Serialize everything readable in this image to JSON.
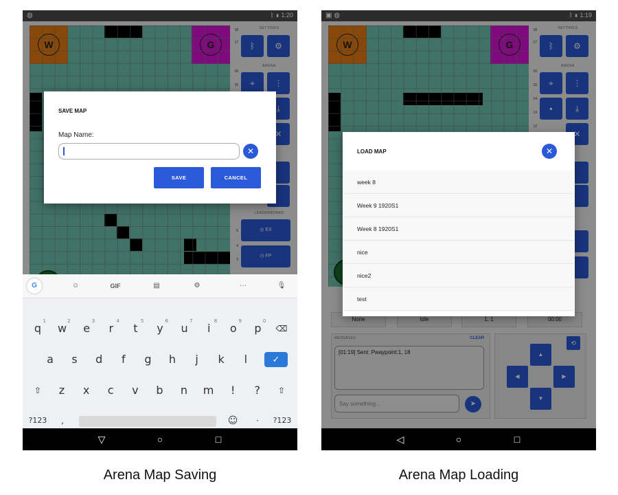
{
  "left": {
    "status_time": "1:20",
    "sidebar": {
      "settings_heading": "SETTINGS",
      "arena_heading": "ARENA",
      "leaderboard_heading": "LEADERBOARD",
      "ex_label": "EX",
      "fp_label": "FP",
      "row_numbers": [
        "18",
        "17",
        "16",
        "15",
        "5",
        "4",
        "3"
      ]
    },
    "start_zone_label": "W",
    "goal_zone_label": "G",
    "dialog": {
      "title": "SAVE MAP",
      "field_label": "Map Name:",
      "input_value": "",
      "save_label": "SAVE",
      "cancel_label": "CANCEL"
    },
    "keyboard": {
      "toolbar_gif": "GIF",
      "row1": [
        "q",
        "w",
        "e",
        "r",
        "t",
        "y",
        "u",
        "i",
        "o",
        "p"
      ],
      "row1_hints": [
        "1",
        "2",
        "3",
        "4",
        "5",
        "6",
        "7",
        "8",
        "9",
        "0"
      ],
      "row2": [
        "a",
        "s",
        "d",
        "f",
        "g",
        "h",
        "j",
        "k",
        "l"
      ],
      "row3": [
        "z",
        "x",
        "c",
        "v",
        "b",
        "n",
        "m",
        "!",
        "?"
      ],
      "symbols_label": "?123",
      "comma": ",",
      "period": "·",
      "symbols_label_right": "?123"
    },
    "caption": "Arena Map Saving"
  },
  "right": {
    "status_time": "1:19",
    "sidebar": {
      "settings_heading": "SETTINGS",
      "arena_heading": "ARENA",
      "row_numbers": [
        "18",
        "17",
        "16",
        "15",
        "14",
        "13",
        "12"
      ]
    },
    "start_zone_label": "W",
    "goal_zone_label": "G",
    "dialog": {
      "title": "LOAD MAP",
      "maps": [
        "week 8",
        "Week 9 1920S1",
        "Week 8 1920S1",
        "nice",
        "nice2",
        "test"
      ]
    },
    "info_bar": [
      "None",
      "Idle",
      "1, 1",
      "00:00"
    ],
    "messages": {
      "heading": "MESSAGES",
      "clear_label": "CLEAR",
      "log": "[01:19] Sent: Pwaypoint:1, 18",
      "input_placeholder": "Say something..."
    },
    "caption": "Arena Map Loading"
  },
  "colors": {
    "accent": "#2a5ad8",
    "arena": "#6fc4b2",
    "start_zone": "#e87d10",
    "goal_zone": "#d914d9",
    "obstacle": "#000000"
  }
}
